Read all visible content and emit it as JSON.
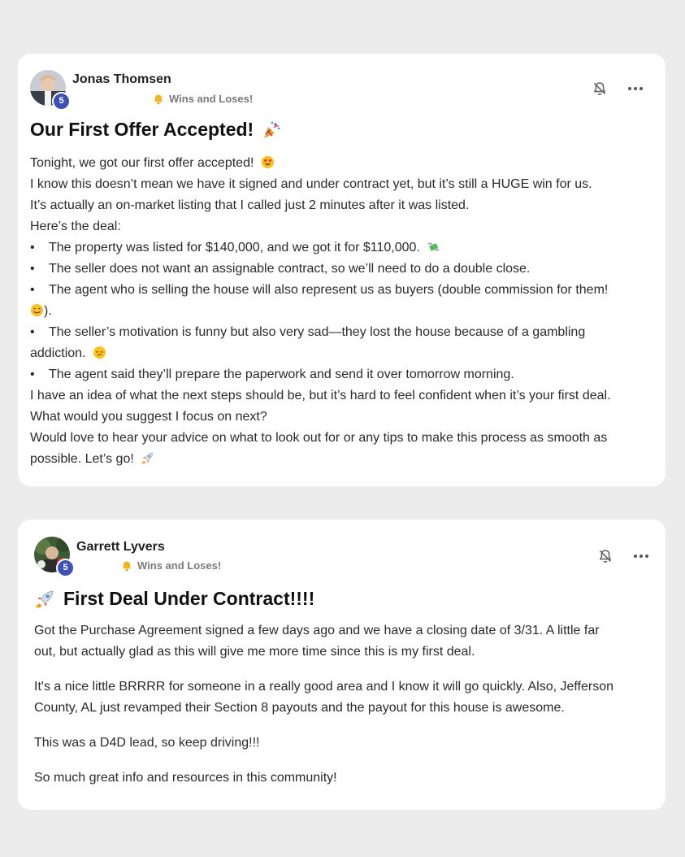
{
  "posts": [
    {
      "author": "Jonas Thomsen",
      "level": "5",
      "category": "Wins and Loses!",
      "title": "Our First Offer Accepted!",
      "lines": {
        "l1": "Tonight, we got our first offer accepted!",
        "l2": "I know this doesn’t mean we have it signed and under contract yet, but it’s still a HUGE win for us.",
        "l3": "It’s actually an on-market listing that I called just 2 minutes after it was listed.",
        "l4": "Here’s the deal:",
        "b1": "The property was listed for $140,000, and we got it for $110,000.",
        "b2": "The seller does not want an assignable contract, so we’ll need to do a double close.",
        "b3a": "The agent who is selling the house will also represent us as buyers (double commission for them!",
        "b3b": ").",
        "b4a": "The seller’s motivation is funny but also very sad—they lost the house because of a gambling",
        "b4b": "addiction.",
        "b5": "The agent said they’ll prepare the paperwork and send it over tomorrow morning.",
        "l5": "I have an idea of what the next steps should be, but it’s hard to feel confident when it’s your first deal.",
        "l6": "What would you suggest I focus on next?",
        "l7": "Would love to hear your advice on what to look out for or any tips to make this process as smooth as",
        "l8": "possible. Let’s go!"
      }
    },
    {
      "author": "Garrett Lyvers",
      "level": "5",
      "category": "Wins and Loses!",
      "title": "First Deal Under Contract!!!!",
      "paragraphs": {
        "p1a": "Got the Purchase Agreement signed a few days ago and we have a closing date of 3/31. A little far",
        "p1b": "out, but actually glad as this will give me more time since this is my first deal.",
        "p2a": "It's a nice little BRRRR for someone in a really good area and I know it will go quickly. Also, Jefferson",
        "p2b": "County, AL just revamped their Section 8 payouts and the payout for this house is awesome.",
        "p3": "This was a D4D lead, so keep driving!!!",
        "p4": "So much great info and resources in this community!"
      }
    }
  ],
  "bullet_char": "•",
  "icons": {
    "notify": "bell-off-icon",
    "more": "more-horizontal-icon",
    "category": "bell-icon"
  },
  "colors": {
    "background": "#ececec",
    "card": "#ffffff",
    "level_badge": "#3f51b5",
    "category_text": "#7a7a7a"
  }
}
